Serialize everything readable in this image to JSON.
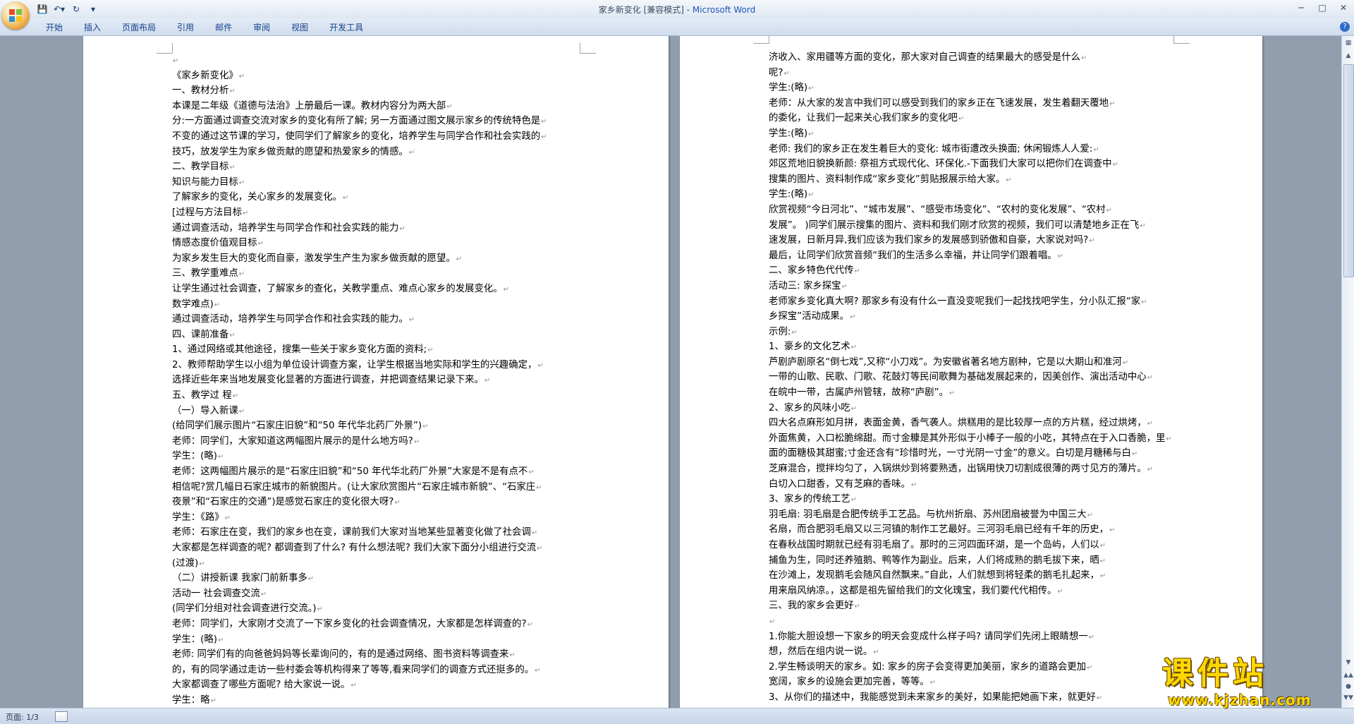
{
  "window": {
    "title_doc": "家乡新变化 [兼容模式] - ",
    "title_app": "Microsoft Word"
  },
  "quick_access": [
    "save-icon",
    "undo-icon",
    "redo-icon",
    "customize-icon"
  ],
  "ribbon": {
    "tabs": [
      "开始",
      "插入",
      "页面布局",
      "引用",
      "邮件",
      "审阅",
      "视图",
      "开发工具"
    ]
  },
  "document": {
    "left_page_lines": [
      "",
      "《家乡新变化》",
      "一、教材分析",
      "本课是二年级《道德与法治》上册最后一课。教材内容分为两大部",
      "分:一方面通过调查交流对家乡的变化有所了解; 另一方面通过图文展示家乡的传统特色是",
      "不变的通过这节课的学习，使同学们了解家乡的变化，培养学生与同学合作和社会实践的",
      "技巧，放发学生为家乡做贡献的愿望和热爱家乡的情感。",
      "二、教学目标",
      "知识与能力目标",
      "了解家乡的变化，关心家乡的发展变化。",
      "[过程与方法目标",
      "通过调查活动，培养学生与同学合作和社会实践的能力",
      "情感态度价值观目标",
      "为家乡发生巨大的变化而自豪，激发学生产生为家乡做贡献的愿望。",
      "三、教学重难点",
      "让学生通过社会调查，了解家乡的查化，关教学重点、难点心家乡的发展变化。",
      "数学难点)",
      "通过调查活动，培养学生与同学合作和社会实践的能力。",
      "四、课前准备",
      "1、通过网络或其他途径，搜集一些关于家乡变化方面的资料;",
      "2、教师帮助学生以小组为单位设计调查方案，让学生根据当地实际和学生的兴趣确定，",
      "选择近些年来当地发展变化显著的方面进行调查，并把调查结果记录下来。",
      "五、教学过 程",
      "（一）导入新课",
      "(给同学们展示图片“石家庄旧貌”和“50 年代华北药厂外景”)",
      "老师：同学们，大家知道这两幅图片展示的是什么地方吗?",
      "学生：(略)",
      "老师：这两幅图片展示的是“石家庄旧貌”和“50 年代华北药厂外景”大家是不是有点不",
      "相信呢?赏几幅日石家庄城市的新貌图片。(让大家欣赏图片“石家庄城市新貌”、“石家庄",
      "夜景”和“石家庄的交通”)是感觉石家庄的变化很大呀?",
      "学生：《路》",
      "老师：石家庄在变，我们的家乡也在变，课前我们大家对当地某些显著变化做了社会调",
      "大家都是怎样调查的呢? 都调查到了什么? 有什么想法呢? 我们大家下面分小组进行交流",
      "(过渡)",
      "（二）讲授新课    我家门前新事多",
      "活动一        社会调查交流",
      "(同学们分组对社会调查进行交流。)",
      "老师：同学们，大家刚才交流了一下家乡变化的社会调查情况，大家都是怎样调查的?",
      "学生：(略)",
      "老师: 同学们有的向爸爸妈妈等长辈询问的，有的是通过网络、图书资料等调查来",
      "的，有的同学通过走访一些村委会等机构得来了等等,看来同学们的调查方式还挺多的。",
      "大家都调查了哪些方面呢? 给大家说一说。",
      "学生：略"
    ],
    "right_page_lines": [
      "济收入、家用疆等方面的变化，那大家对自己调查的结果最大的感受是什么",
      "呢?",
      "学生:(略)",
      "老师：从大家的发言中我们可以感受到我们的家乡正在飞速发展，发生着翻天覆地",
      "的委化，让我们一起来关心我们家乡的变化吧",
      "学生:(略)",
      "老师: 我们的家乡正在发生着巨大的变化: 城市街遭改头换面; 休闲锻炼人人爱:",
      "郊区荒地旧貌换新颜: 祭祖方式现代化、环保化.-下面我们大家可以把你们在调查中",
      "搜集的图片、资料制作成“家乡变化”剪贴报展示给大家。",
      "学生:(略)",
      "欣赏视频“今日河北”、“城市发展”、“感受市场变化”、“农村的变化发展”、“农村",
      "发展”。 )同学们展示搜集的图片、资料和我们刚才欣赏的视频，我们可以清楚地乡正在飞",
      "速发展，日新月异,我们应该为我们家乡的发展感到骄傲和自豪，大家说对吗?",
      "最后，让同学们欣赏音频“我们的生活多么幸福，并让同学们跟着唱。",
      "二、家乡特色代代传",
      "活动三: 家乡探宝",
      "老师家乡变化真大啊? 那家乡有没有什么一直没变呢我们一起找找吧学生，分小队汇报“家",
      "乡探宝”活动成果。",
      "示例:",
      "1、豪乡的文化艺术",
      "芦剧庐剧原名“倒七戏”,又称“小刀戏”。为安徽省著名地方剧种，它是以大期山和准河",
      "一带的山歌、民歌、门歌、花鼓灯等民间歌舞为基础发展起来的，因美创作、演出活动中心",
      "在皖中一带，古属庐州管辖，故称“庐剧”。",
      "2、家乡的风味小吃",
      "四大名点麻形如月拼，表面金黄，香气袭人。烘糕用的是比较厚一点的方片糕，经过烘烤，",
      "外面焦黄，入口松脆绵甜。而寸金糠是其外形似于小棒子一般的小吃，其特点在于入口香脆，里",
      "面的面糖极其甜蜜;寸金还含有“珍惜时光，一寸光阴一寸金”的意义。白切是月糖稀与白",
      "芝麻混合，搅拌均匀了，入锅烘炒到将要熟透，出锅用快刀切割成很薄的两寸见方的薄片。",
      "白切入口甜香，又有芝麻的香味。",
      "3、家乡的传统工艺",
      "羽毛扇:   羽毛扇是合肥传统手工艺品。与杭州折扇、苏州团扇被誉为中国三大",
      "名扇，而合肥羽毛扇又以三河镇的制作工艺最好。三河羽毛扇已经有千年的历史，",
      "在春秋战国时期就已经有羽毛扇了。那时的三河四面环湖，是一个岛屿，人们以",
      "捕鱼为生，同时还养殖鹅、鸭等作为副业。后来，人们将成熟的鹅毛拔下来，晒",
      "在沙滩上，发现鹅毛会随风自然飘来。”自此，人们就想到将轻柔的鹅毛扎起来，",
      "用来扇风纳凉。，这都是祖先留给我们的文化瑰宝，我们要代代相传。",
      "三、我的家乡会更好",
      "",
      "1.你能大胆设想一下家乡的明天会变成什么样子吗? 请同学们先闭上眼睛想一",
      "想，然后在组内说一说。",
      "2.学生畅谈明天的家乡。如:  家乡的房子会变得更加美丽，家乡的道路会更加",
      "宽阔，家乡的设施会更加完善，等等。",
      "3、从你们的描述中，我能感觉到未来家乡的美好，如果能把她画下来，就更好"
    ]
  },
  "statusbar": {
    "page_indicator": "页面: 1/3"
  },
  "watermark": {
    "text": "课件站",
    "url": "www.kjzhan.com"
  }
}
